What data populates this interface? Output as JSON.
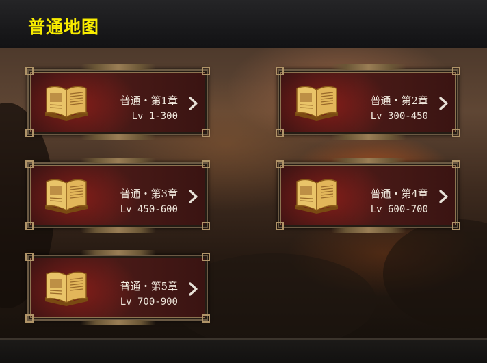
{
  "header": {
    "title": "普通地图"
  },
  "chapters": [
    {
      "name": "普通・第1章",
      "level": "Lv 1-300"
    },
    {
      "name": "普通・第2章",
      "level": "Lv 300-450"
    },
    {
      "name": "普通・第3章",
      "level": "Lv 450-600"
    },
    {
      "name": "普通・第4章",
      "level": "Lv 600-700"
    },
    {
      "name": "普通・第5章",
      "level": "Lv 700-900"
    }
  ],
  "icons": {
    "chapter_icon": "open-book-icon",
    "enter_icon": "chevron-right-icon"
  },
  "colors": {
    "title": "#f8ec00",
    "card_bg": "#4a1a17",
    "frame": "#8c7350",
    "text": "#efe7dc"
  }
}
